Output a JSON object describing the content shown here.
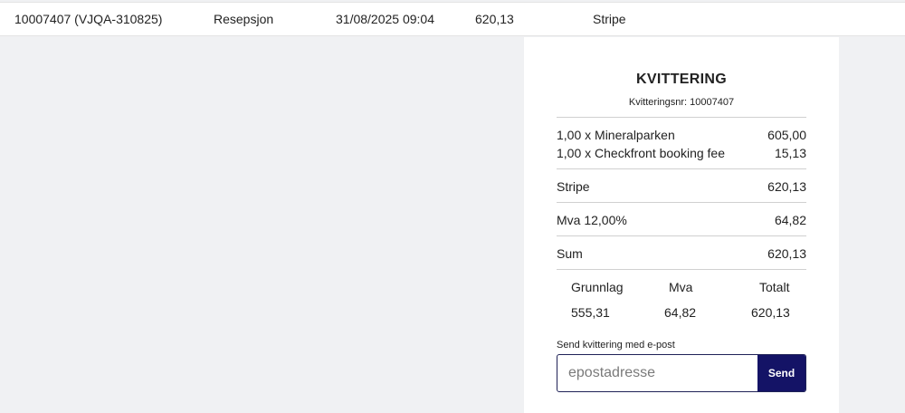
{
  "transaction_row": {
    "id": "10007407 (VJQA-310825)",
    "location": "Resepsjon",
    "datetime": "31/08/2025 09:04",
    "amount": "620,13",
    "payment_method": "Stripe"
  },
  "receipt": {
    "title": "KVITTERING",
    "number_label": "Kvitteringsnr:",
    "number": "10007407",
    "items": [
      {
        "description": "1,00 x Mineralparken",
        "amount": "605,00"
      },
      {
        "description": "1,00 x Checkfront booking fee",
        "amount": "15,13"
      }
    ],
    "payment": {
      "label": "Stripe",
      "amount": "620,13"
    },
    "vat": {
      "label": "Mva 12,00%",
      "amount": "64,82"
    },
    "sum": {
      "label": "Sum",
      "amount": "620,13"
    },
    "summary": {
      "headers": [
        "Grunnlag",
        "Mva",
        "Totalt"
      ],
      "values": [
        "555,31",
        "64,82",
        "620,13"
      ]
    },
    "email": {
      "label": "Send kvittering med e-post",
      "placeholder": "epostadresse",
      "value": "",
      "button_label": "Send"
    }
  },
  "colors": {
    "background": "#f0f1f3",
    "send_button": "#141366"
  }
}
